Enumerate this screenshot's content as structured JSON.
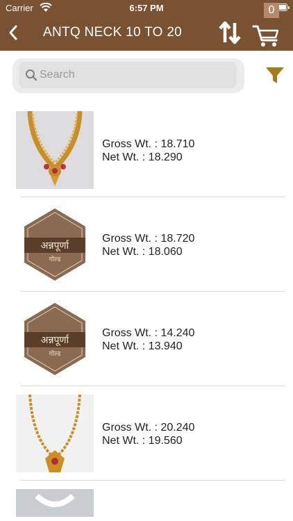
{
  "status_bar": {
    "carrier": "Carrier",
    "time": "6:57 PM"
  },
  "nav": {
    "title": "ANTQ NECK 10 TO 20",
    "cart_count": "0"
  },
  "search": {
    "placeholder": "Search",
    "value": ""
  },
  "colors": {
    "header": "#7a5231",
    "accent": "#a67c1a",
    "badge": "#b48a6b"
  },
  "items": [
    {
      "gross_label": "Gross Wt. : ",
      "gross": "18.710",
      "net_label": "Net Wt. : ",
      "net": "18.290",
      "image": "necklace-photo"
    },
    {
      "gross_label": "Gross Wt. : ",
      "gross": "18.720",
      "net_label": "Net Wt. : ",
      "net": "18.060",
      "image": "brand-placeholder-logo"
    },
    {
      "gross_label": "Gross Wt. : ",
      "gross": "14.240",
      "net_label": "Net Wt. : ",
      "net": "13.940",
      "image": "brand-placeholder-logo"
    },
    {
      "gross_label": "Gross Wt. : ",
      "gross": "20.240",
      "net_label": "Net Wt. : ",
      "net": "19.560",
      "image": "long-necklace-photo"
    }
  ],
  "placeholder_logo": {
    "brand": "अन्नपूर्णा",
    "sub": "गोल्ड"
  }
}
